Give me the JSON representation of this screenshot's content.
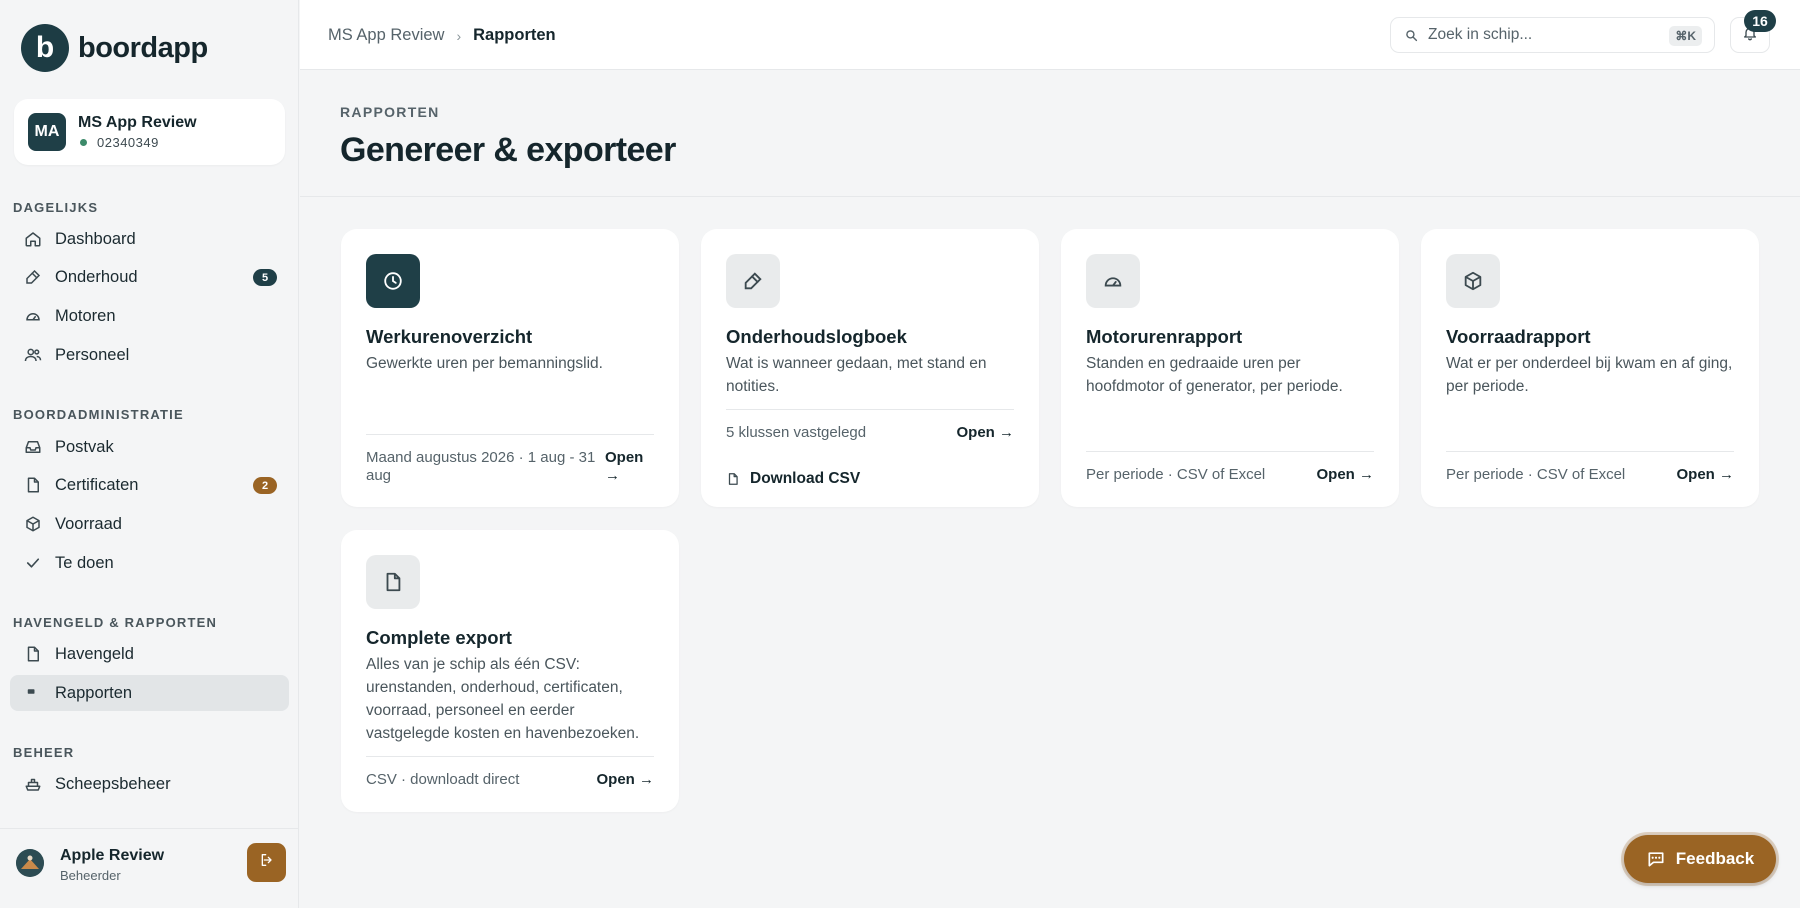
{
  "brand": {
    "logo_letter": "b",
    "name": "boordapp"
  },
  "ship": {
    "initials": "MA",
    "name": "MS App Review",
    "number": "02340349",
    "status_color": "#3c8a6a"
  },
  "sidebar": {
    "sections": [
      {
        "title": "DAGELIJKS"
      },
      {
        "title": "BOORDADMINISTRATIE"
      },
      {
        "title": "HAVENGELD & RAPPORTEN"
      },
      {
        "title": "BEHEER"
      }
    ],
    "items": [
      {
        "label": "Dashboard",
        "icon": "home-icon"
      },
      {
        "label": "Onderhoud",
        "icon": "wrench-icon",
        "badge": "5"
      },
      {
        "label": "Motoren",
        "icon": "gauge-icon"
      },
      {
        "label": "Personeel",
        "icon": "users-icon"
      },
      {
        "label": "Postvak",
        "icon": "inbox-icon"
      },
      {
        "label": "Certificaten",
        "icon": "file-icon",
        "badge": "2"
      },
      {
        "label": "Voorraad",
        "icon": "box-icon"
      },
      {
        "label": "Te doen",
        "icon": "check-icon"
      },
      {
        "label": "Havengeld",
        "icon": "file-icon"
      },
      {
        "label": "Rapporten",
        "icon": "flag-icon",
        "active": true
      },
      {
        "label": "Scheepsbeheer",
        "icon": "ship-icon"
      }
    ]
  },
  "user": {
    "name": "Apple Review",
    "role": "Beheerder"
  },
  "topbar": {
    "breadcrumb": [
      "MS App Review",
      "Rapporten"
    ],
    "search_placeholder": "Zoek in schip...",
    "search_shortcut": "⌘K",
    "notifications_count": "16"
  },
  "header": {
    "eyebrow": "RAPPORTEN",
    "title": "Genereer & exporteer"
  },
  "cards": [
    {
      "title": "Werkurenoverzicht",
      "description": "Gewerkte uren per bemanningslid.",
      "meta": "Maand augustus 2026 · 1 aug - 31 aug",
      "action": "Open →",
      "icon": "clock-icon"
    },
    {
      "title": "Onderhoudslogboek",
      "description": "Wat is wanneer gedaan, met stand en notities.",
      "meta": "5 klussen vastgelegd",
      "action": "Open →",
      "download": "Download CSV",
      "icon": "wrench-icon"
    },
    {
      "title": "Motorurenrapport",
      "description": "Standen en gedraaide uren per hoofdmotor of generator, per periode.",
      "meta": "Per periode · CSV of Excel",
      "action": "Open →",
      "icon": "gauge-icon"
    },
    {
      "title": "Voorraadrapport",
      "description": "Wat er per onderdeel bij kwam en af ging, per periode.",
      "meta": "Per periode · CSV of Excel",
      "action": "Open →",
      "icon": "box-icon"
    },
    {
      "title": "Complete export",
      "description": "Alles van je schip als één CSV: urenstanden, onderhoud, certificaten, voorraad, personeel en eerder vastgelegde kosten en havenbezoeken.",
      "meta": "CSV · downloadt direct",
      "action": "Open →",
      "icon": "file-icon"
    }
  ],
  "feedback": {
    "label": "Feedback"
  },
  "colors": {
    "primary": "#1f3f47",
    "accent": "#9a6424",
    "background": "#f4f5f6"
  }
}
